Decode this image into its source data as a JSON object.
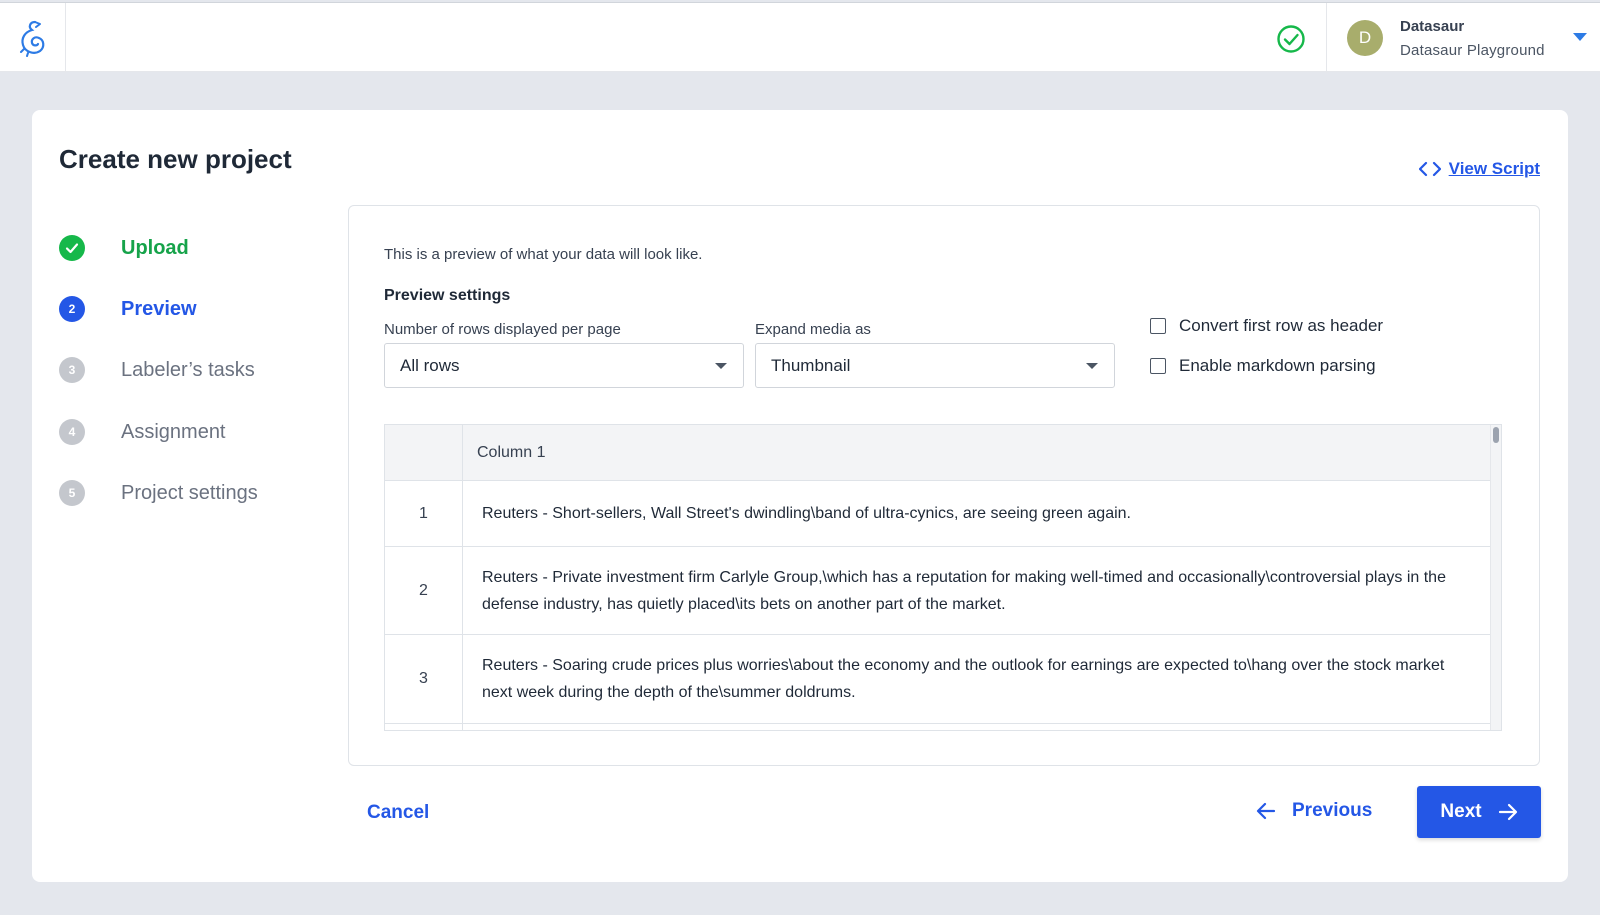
{
  "topbar": {
    "logo_icon": "datasaur-logo-icon",
    "status_icon": "check-circle-icon",
    "user": {
      "initial": "D",
      "name": "Datasaur",
      "org": "Datasaur Playground",
      "dropdown_icon": "caret-down-icon"
    }
  },
  "page": {
    "title": "Create new project",
    "view_script": "View Script",
    "view_script_icon": "code-icon"
  },
  "steps": [
    {
      "number": "1",
      "label": "Upload",
      "state": "done"
    },
    {
      "number": "2",
      "label": "Preview",
      "state": "active"
    },
    {
      "number": "3",
      "label": "Labeler’s tasks",
      "state": "todo"
    },
    {
      "number": "4",
      "label": "Assignment",
      "state": "todo"
    },
    {
      "number": "5",
      "label": "Project settings",
      "state": "todo"
    }
  ],
  "preview": {
    "intro": "This is a preview of what your data will look like.",
    "settings_title": "Preview settings",
    "rows_label": "Number of rows displayed per page",
    "rows_value": "All rows",
    "media_label": "Expand media as",
    "media_value": "Thumbnail",
    "checkbox_header": "Convert first row as header",
    "checkbox_markdown": "Enable markdown parsing",
    "table": {
      "column_header": "Column 1",
      "rows": [
        {
          "index": "1",
          "text": "Reuters - Short-sellers, Wall Street's dwindling\\band of ultra-cynics, are seeing green again."
        },
        {
          "index": "2",
          "text": "Reuters - Private investment firm Carlyle Group,\\which has a reputation for making well-timed and occasionally\\controversial plays in the defense industry, has quietly placed\\its bets on another part of the market."
        },
        {
          "index": "3",
          "text": "Reuters - Soaring crude prices plus worries\\about the economy and the outlook for earnings are expected to\\hang over the stock market next week during the depth of the\\summer doldrums."
        }
      ]
    }
  },
  "actions": {
    "cancel": "Cancel",
    "previous": "Previous",
    "next": "Next"
  },
  "colors": {
    "primary": "#2457e6",
    "success": "#16b84a",
    "muted": "#c4c7cd",
    "background": "#e4e7ed"
  }
}
